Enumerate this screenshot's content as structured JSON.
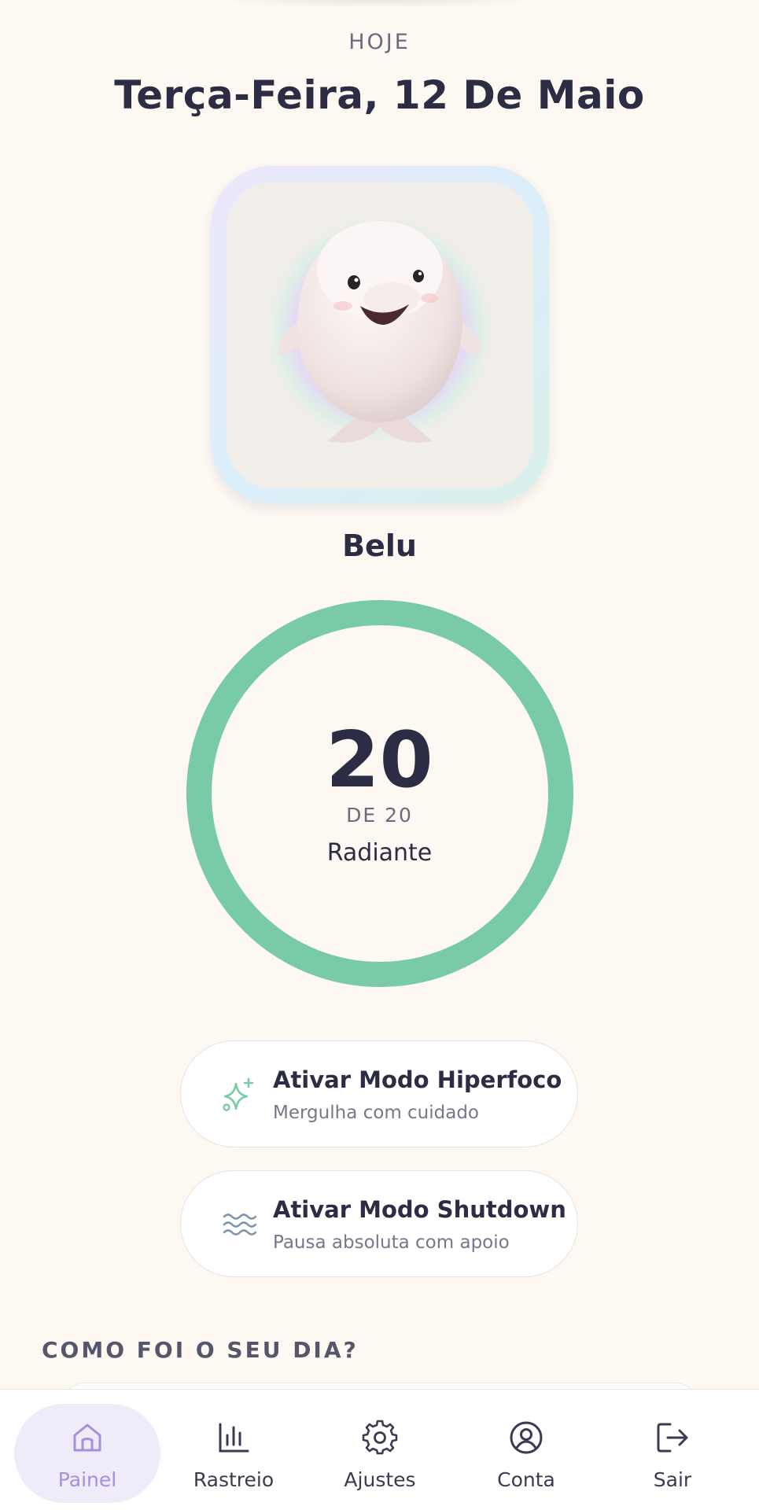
{
  "header": {
    "today_label": "HOJE",
    "date": "Terça-Feira, 12 De Maio"
  },
  "pet": {
    "name": "Belu",
    "image": "beluga-whale-mascot"
  },
  "score": {
    "value": "20",
    "of_label": "DE 20",
    "status": "Radiante",
    "fraction": 1.0,
    "ring_color": "#79cba6"
  },
  "modes": [
    {
      "title": "Ativar Modo Hiperfoco",
      "subtitle": "Mergulha com cuidado",
      "icon": "sparkles-icon",
      "icon_color": "#79cba6"
    },
    {
      "title": "Ativar Modo Shutdown",
      "subtitle": "Pausa absoluta com apoio",
      "icon": "waves-icon",
      "icon_color": "#7f97ad"
    }
  ],
  "section": {
    "title": "COMO FOI O SEU DIA?"
  },
  "nav": {
    "active_color": "#a392d9",
    "items": [
      {
        "label": "Painel",
        "icon": "home-icon",
        "active": true
      },
      {
        "label": "Rastreio",
        "icon": "bar-chart-icon",
        "active": false
      },
      {
        "label": "Ajustes",
        "icon": "gear-icon",
        "active": false
      },
      {
        "label": "Conta",
        "icon": "user-circle-icon",
        "active": false
      },
      {
        "label": "Sair",
        "icon": "logout-icon",
        "active": false
      }
    ]
  }
}
